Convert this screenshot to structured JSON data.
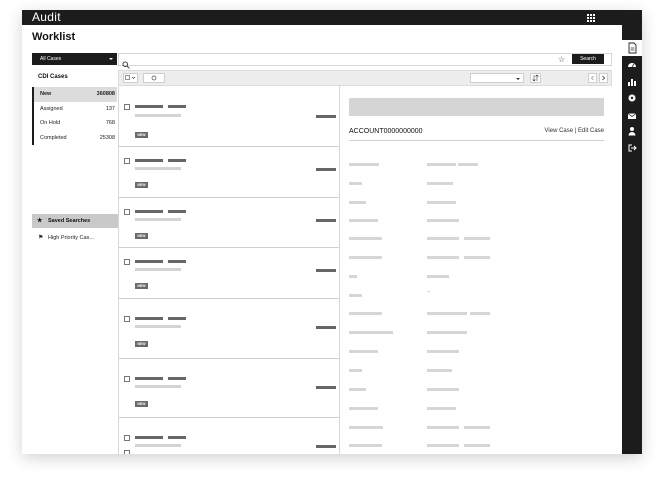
{
  "app": {
    "title": "Audit"
  },
  "page": {
    "title": "Worklist"
  },
  "filter": {
    "selected": "All Cases"
  },
  "cdi": {
    "heading": "CDI Cases",
    "items": [
      {
        "label": "New",
        "count": "360808",
        "selected": true
      },
      {
        "label": "Assigned",
        "count": "137",
        "selected": false
      },
      {
        "label": "On Hold",
        "count": "768",
        "selected": false
      },
      {
        "label": "Completed",
        "count": "25308",
        "selected": false
      }
    ]
  },
  "saved": {
    "heading": "Saved Searches",
    "items": [
      "High Priority Cas..."
    ]
  },
  "search": {
    "placeholder": "",
    "button": "Search"
  },
  "worklist": {
    "badge": "NEW"
  },
  "detail": {
    "account": "ACCOUNT0000000000",
    "view_case": "View Case",
    "separator": " | ",
    "edit_case": "Edit Case",
    "empty_value": "--"
  },
  "icons": {
    "topbar": "app-grid-icon",
    "rail": [
      "document-icon",
      "dashboard-icon",
      "bar-chart-icon",
      "settings-icon",
      "mail-icon",
      "user-icon",
      "logout-icon"
    ],
    "search": "search-icon",
    "favorite": "star-icon",
    "sort": "sort-icon"
  },
  "colors": {
    "chrome": "#1c1c1c",
    "selected_row": "#dcdcdc",
    "saved_header": "#c9c9c9"
  }
}
